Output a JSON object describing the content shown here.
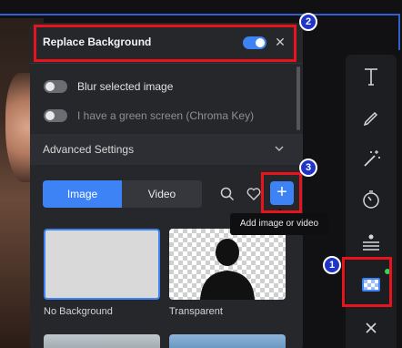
{
  "panel": {
    "title": "Replace Background",
    "replace_toggle_on": true,
    "blur_label": "Blur selected image",
    "blur_on": false,
    "green_label": "I have a green screen (Chroma Key)",
    "green_on": false,
    "advanced_label": "Advanced Settings",
    "tabs": [
      {
        "label": "Image",
        "active": true
      },
      {
        "label": "Video",
        "active": false
      }
    ],
    "add_tooltip": "Add image or video",
    "thumbnails": [
      {
        "caption": "No Background",
        "selected": true
      },
      {
        "caption": "Transparent",
        "selected": false
      }
    ]
  },
  "toolbar": {
    "items": [
      "text-icon",
      "pen-icon",
      "magic-wand-icon",
      "timer-icon",
      "adjust-icon",
      "background-replace-icon",
      "close-icon"
    ]
  },
  "annotations": {
    "badges": [
      "1",
      "2",
      "3"
    ]
  },
  "colors": {
    "accent": "#3d83f5",
    "annotation_red": "#e8141d",
    "badge_blue": "#2034c8",
    "panel_bg": "#26272b",
    "status_dot": "#39d353"
  }
}
